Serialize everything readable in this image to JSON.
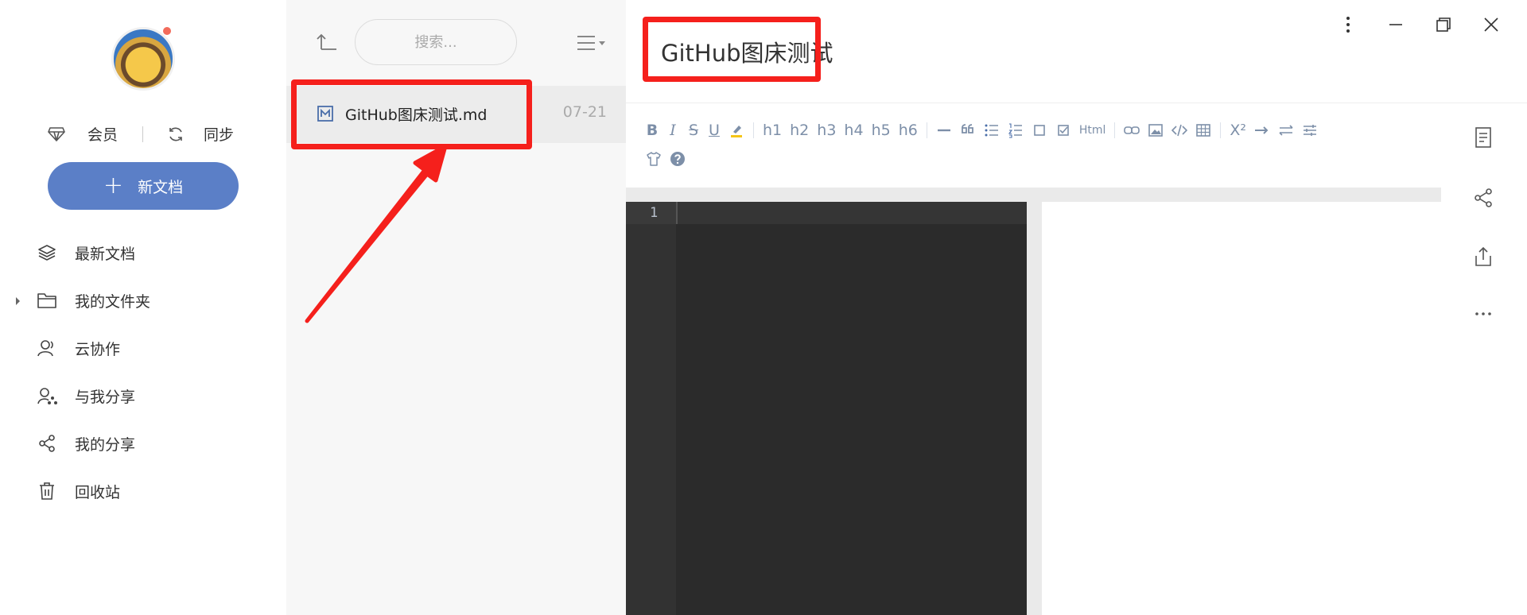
{
  "sidebar": {
    "vip_label": "会员",
    "sync_label": "同步",
    "new_doc_label": "新文档",
    "nav": [
      {
        "label": "最新文档",
        "icon": "layers-icon"
      },
      {
        "label": "我的文件夹",
        "icon": "folder-icon"
      },
      {
        "label": "云协作",
        "icon": "user-icon"
      },
      {
        "label": "与我分享",
        "icon": "user-share-icon"
      },
      {
        "label": "我的分享",
        "icon": "share-icon"
      },
      {
        "label": "回收站",
        "icon": "trash-icon"
      }
    ]
  },
  "filelist": {
    "search_placeholder": "搜索...",
    "files": [
      {
        "name": "GitHub图床测试.md",
        "date": "07-21",
        "icon": "markdown-file-icon"
      }
    ]
  },
  "editor": {
    "title": "GitHub图床测试",
    "toolbar": {
      "headings": [
        "h1",
        "h2",
        "h3",
        "h4",
        "h5",
        "h6"
      ],
      "bold": "B",
      "italic": "I",
      "strike": "S",
      "underline": "U",
      "html": "Html",
      "superscript": "X²"
    },
    "line_number": "1"
  },
  "colors": {
    "accent": "#5b7fc7",
    "highlight_box": "#f5201c",
    "toolbar_icon": "#7d8fa8",
    "code_bg": "#2b2b2b"
  }
}
